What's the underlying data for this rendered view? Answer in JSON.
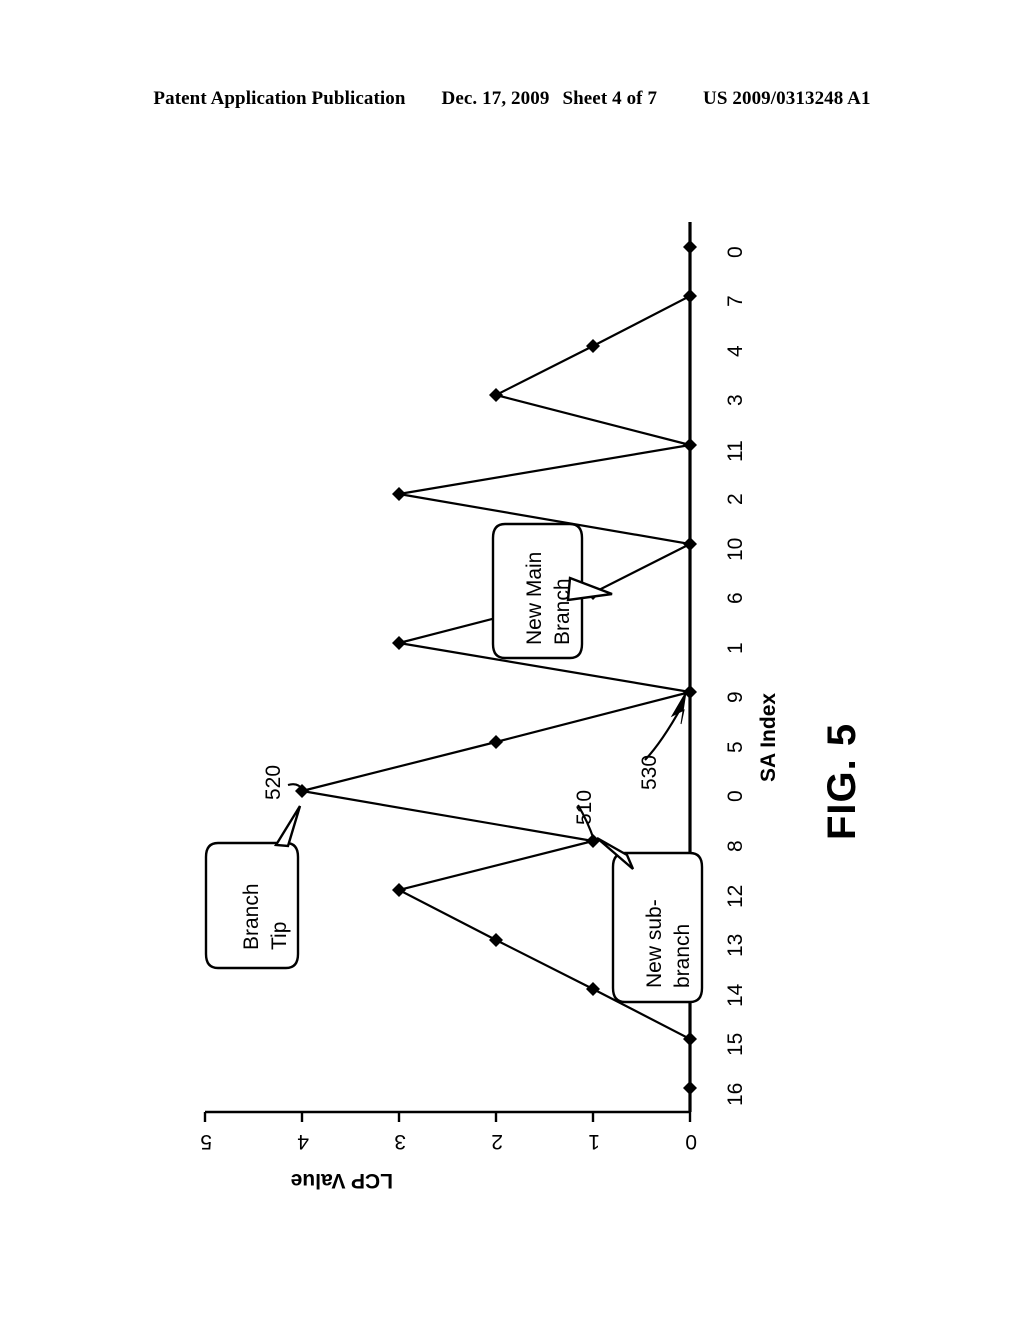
{
  "header": {
    "publication": "Patent Application Publication",
    "date": "Dec. 17, 2009",
    "sheet": "Sheet 4 of 7",
    "number": "US 2009/0313248 A1"
  },
  "figure": {
    "caption": "FIG. 5",
    "callouts": [
      {
        "id": "branch-tip",
        "line1": "Branch",
        "line2": "Tip",
        "ref": "520"
      },
      {
        "id": "new-main-branch",
        "line1": "New Main",
        "line2": "Branch",
        "ref": ""
      },
      {
        "id": "new-sub-branch",
        "line1": "New sub-",
        "line2": "branch",
        "ref": "510"
      }
    ],
    "reference_numerals": [
      {
        "label": "520",
        "points_to": "branch-tip-vertex"
      },
      {
        "label": "510",
        "points_to": "new-sub-branch-vertex"
      },
      {
        "label": "530",
        "points_to": "sa-index-9-vertex"
      }
    ]
  },
  "chart_data": {
    "type": "line",
    "title": "FIG. 5",
    "xlabel": "SA Index",
    "ylabel": "LCP Value",
    "orientation": "rotated-90-ccw",
    "categories": [
      "0",
      "7",
      "4",
      "3",
      "11",
      "2",
      "10",
      "6",
      "1",
      "9",
      "5",
      "0",
      "8",
      "12",
      "13",
      "14",
      "15",
      "16"
    ],
    "values": [
      0,
      0,
      1,
      2,
      0,
      3,
      0,
      1,
      3,
      0,
      2,
      4,
      1,
      3,
      2,
      1,
      0,
      0
    ],
    "xlim": [
      0,
      17
    ],
    "ylim": [
      0,
      5
    ],
    "yticks": [
      "0",
      "1",
      "2",
      "3",
      "4",
      "5"
    ],
    "grid": false,
    "legend": "none",
    "marker": "diamond",
    "annotations": [
      {
        "text": "Branch Tip",
        "at_category": "0",
        "at_value": 4,
        "ref": "520"
      },
      {
        "text": "New sub-branch",
        "at_category": "8",
        "at_value": 1,
        "ref": "510"
      },
      {
        "text": "New Main Branch",
        "at_category": "9",
        "at_value": 0,
        "ref": "530"
      }
    ]
  }
}
